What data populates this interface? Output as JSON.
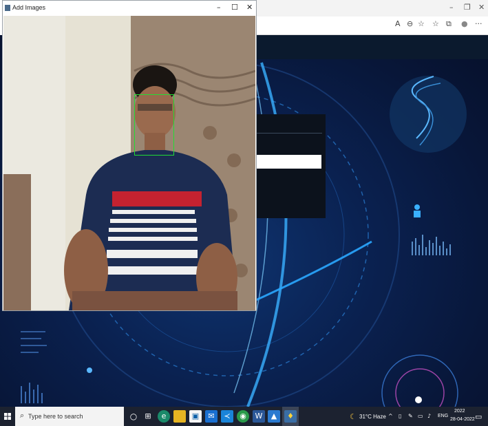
{
  "camera_window": {
    "title": "Add Images",
    "minimize": "–",
    "maximize": "☐",
    "close": "✕"
  },
  "browser": {
    "window_controls": {
      "minimize": "–",
      "restore": "❐",
      "close": "✕"
    },
    "toolbar_icons": [
      "read-aloud-icon",
      "zoom-icon",
      "favorites-add-icon",
      "favorites-icon",
      "collections-icon",
      "profile-icon",
      "more-icon"
    ],
    "toolbar_glyphs": [
      "A",
      "⊖",
      "☆",
      "☆",
      "⧉",
      "●",
      "···"
    ]
  },
  "taskbar": {
    "search_placeholder": "Type here to search",
    "weather": "31°C  Haze",
    "language": "ENG",
    "time": "2022",
    "date": "28-04-2022",
    "apps": [
      "cortana",
      "task-view",
      "edge",
      "file-explorer",
      "store",
      "mail",
      "vscode",
      "chrome",
      "word",
      "photos",
      "python"
    ]
  },
  "colors": {
    "face_box": "#22dd33",
    "scene_glow": "#2aa7ff",
    "taskbar": "#1c2230"
  }
}
